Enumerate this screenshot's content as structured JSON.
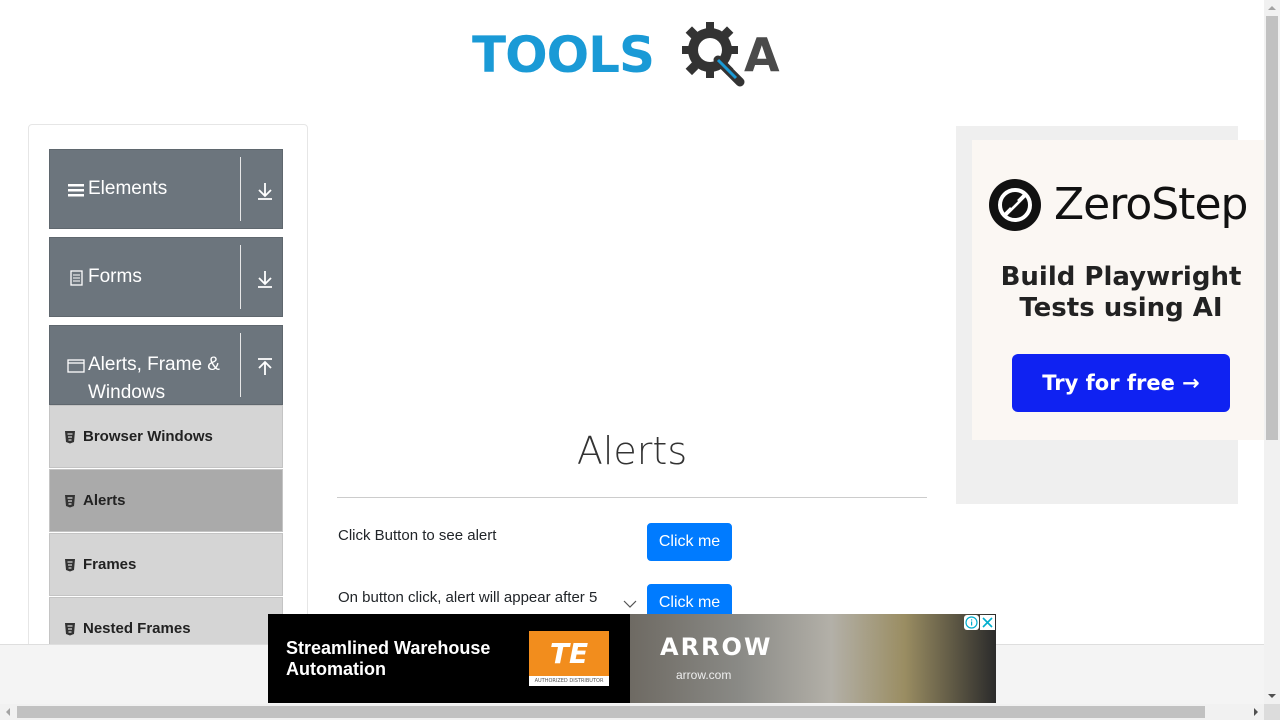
{
  "header": {
    "logo_text": "TOOLS",
    "logo_tail": "A",
    "logo_icon": "gear-magnifier-icon",
    "brand_color": "#1a9ad6"
  },
  "sidebar": {
    "groups": [
      {
        "label": "Elements",
        "icon": "hamburger-icon",
        "arrow": "download-arrow-icon"
      },
      {
        "label": "Forms",
        "icon": "document-icon",
        "arrow": "download-arrow-icon"
      },
      {
        "label_line1": "Alerts, Frame &",
        "label_line2": "Windows",
        "icon": "window-icon",
        "arrow": "upload-arrow-icon"
      }
    ],
    "items": [
      {
        "label": "Browser Windows",
        "icon": "html5-icon",
        "active": false
      },
      {
        "label": "Alerts",
        "icon": "html5-icon",
        "active": true
      },
      {
        "label": "Frames",
        "icon": "html5-icon",
        "active": false
      },
      {
        "label": "Nested Frames",
        "icon": "html5-icon",
        "active": false
      }
    ]
  },
  "main": {
    "title": "Alerts",
    "rows": [
      {
        "text": "Click Button to see alert",
        "button": "Click me"
      },
      {
        "text": "On button click, alert will appear after 5",
        "button": "Click me"
      }
    ]
  },
  "ad_right": {
    "brand": "ZeroStep",
    "tagline_line1": "Build Playwright",
    "tagline_line2": "Tests using AI",
    "cta": "Try for free →",
    "cta_color": "#0f22f2"
  },
  "ad_bottom": {
    "headline_line1": "Streamlined Warehouse",
    "headline_line2": "Automation",
    "te_logo": "TE",
    "te_sub": "AUTHORIZED DISTRIBUTOR",
    "arrow_brand": "ARROW",
    "arrow_url": "arrow.com"
  },
  "colors": {
    "nav_header": "#6c757d",
    "nav_item": "#d5d5d5",
    "nav_item_active": "#aaaaaa",
    "button": "#007bff"
  }
}
